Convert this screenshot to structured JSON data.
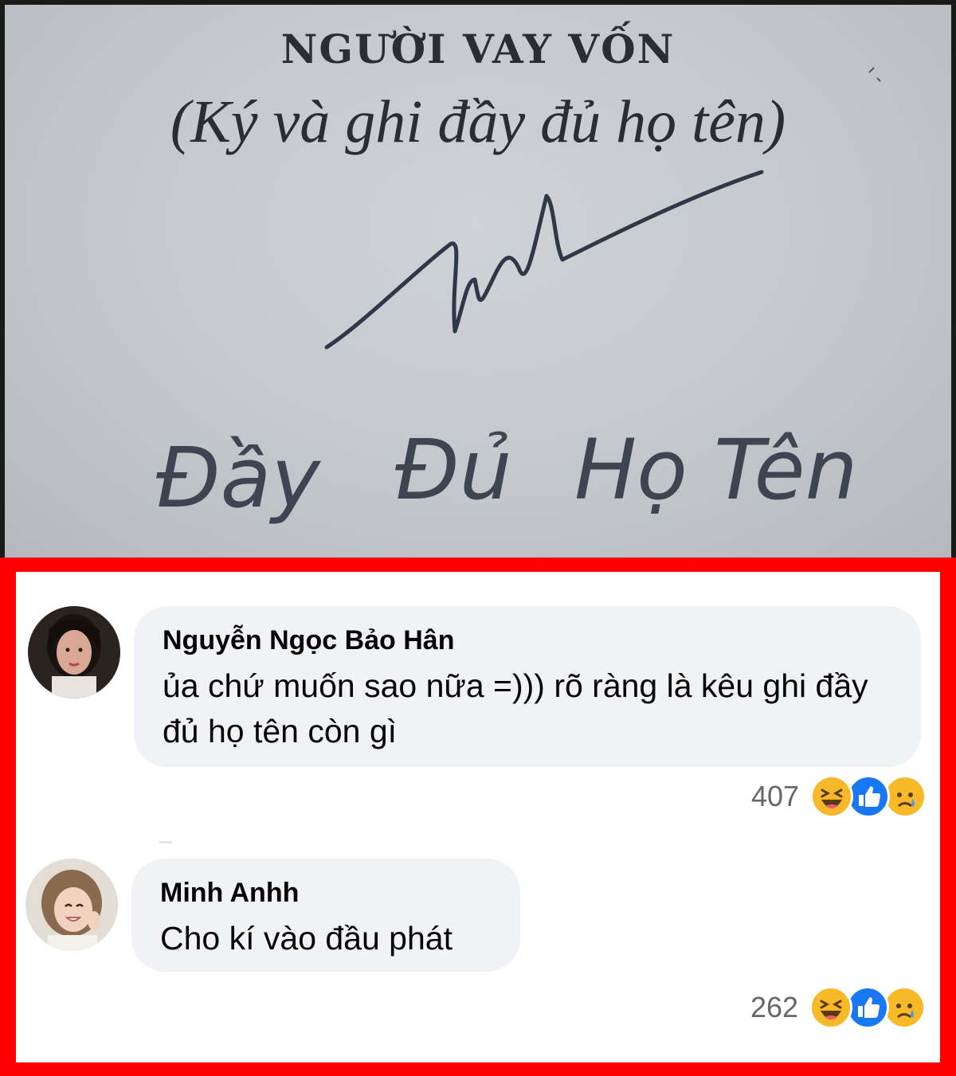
{
  "document": {
    "heading": "NGƯỜI VAY VỐN",
    "subheading": "(Ký và ghi đầy đủ họ tên)",
    "handwritten_name": [
      "Đầy",
      "Đủ",
      "Họ",
      "Tên"
    ]
  },
  "comments": [
    {
      "author": "Nguyễn Ngọc Bảo Hân",
      "text": "ủa chứ muốn sao nữa =))) rõ ràng là kêu ghi đầy đủ họ tên còn gì",
      "reaction_count": "407",
      "reactions": [
        "haha-icon",
        "like-icon",
        "sad-icon"
      ]
    },
    {
      "author": "Minh Anhh",
      "text": "Cho kí vào đầu phát",
      "reaction_count": "262",
      "reactions": [
        "haha-icon",
        "like-icon",
        "sad-icon"
      ]
    }
  ],
  "colors": {
    "frame": "#ff0000",
    "bubble": "#f0f2f5",
    "like_blue": "#1877f2",
    "haha_yellow": "#f7b928"
  }
}
